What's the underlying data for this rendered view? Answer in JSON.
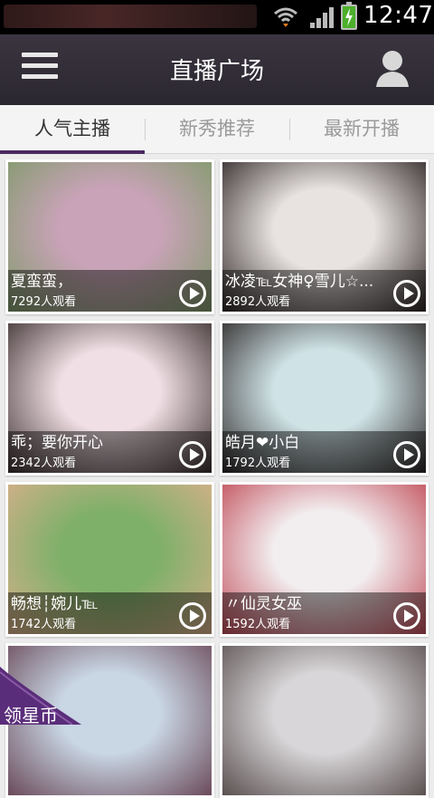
{
  "status_bar": {
    "time": "12:47",
    "icons": [
      "wifi-icon",
      "signal-icon",
      "battery-charging-icon"
    ]
  },
  "header": {
    "title": "直播广场",
    "menu_icon": "menu-icon",
    "profile_icon": "user-icon"
  },
  "tabs": [
    {
      "label": "人气主播",
      "active": true
    },
    {
      "label": "新秀推荐",
      "active": false
    },
    {
      "label": "最新开播",
      "active": false
    }
  ],
  "streams": [
    {
      "name": "夏蛮蛮，",
      "viewers": "7292人观看",
      "color_a": "#c9a3b8",
      "color_b": "#7f9a6a"
    },
    {
      "name": "冰凌℡女神♀雪儿☆...",
      "viewers": "2892人观看",
      "color_a": "#e8e3e0",
      "color_b": "#2c2424"
    },
    {
      "name": "乖；要你开心",
      "viewers": "2342人观看",
      "color_a": "#f0dfe4",
      "color_b": "#3a2e2e"
    },
    {
      "name": "皓月❤小白",
      "viewers": "1792人观看",
      "color_a": "#cfe3e6",
      "color_b": "#2a2424"
    },
    {
      "name": "畅想┆婉儿℡",
      "viewers": "1742人观看",
      "color_a": "#7fb06a",
      "color_b": "#d8b08a"
    },
    {
      "name": "〃仙灵女巫",
      "viewers": "1592人观看",
      "color_a": "#f2eef0",
      "color_b": "#c04a56"
    },
    {
      "name": "",
      "viewers": "",
      "color_a": "#c9d6e4",
      "color_b": "#6a4a5a"
    },
    {
      "name": "",
      "viewers": "",
      "color_a": "#d8d6d8",
      "color_b": "#5a5050"
    }
  ],
  "coin_badge": {
    "label": "领星币",
    "color": "#5a2d7a"
  },
  "colors": {
    "title_bar": "#2b272f",
    "tab_indicator": "#4b2a62",
    "background": "#ececec"
  }
}
